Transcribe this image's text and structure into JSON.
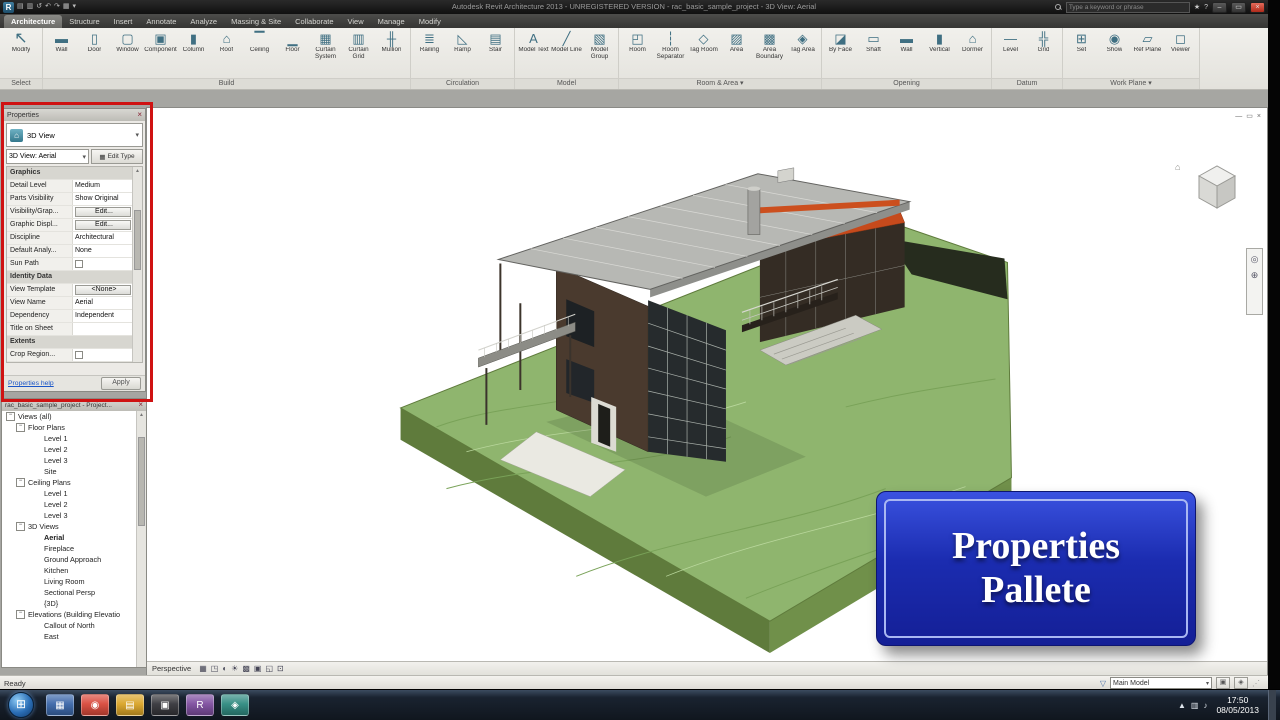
{
  "colors": {
    "highlight_red": "#cf1212",
    "callout_blue": "#1b2cb0",
    "accent_orange": "#c64a1c",
    "terrain_green": "#8fb56e",
    "roof_gray": "#b7b8b4",
    "taskbar_dark": "#10161e"
  },
  "titlebar": {
    "title": "Autodesk Revit Architecture 2013 - UNREGISTERED VERSION - rac_basic_sample_project - 3D View: Aerial",
    "logo": "R",
    "qat": [
      "▤",
      "▥",
      "↺",
      "↶",
      "↷",
      "▦",
      "▾"
    ],
    "search_placeholder": "Type a keyword or phrase",
    "star": "★",
    "help": "?",
    "window_buttons": {
      "minimize": "–",
      "maximize": "▭",
      "close": "×"
    }
  },
  "ribbon": {
    "tabs": [
      {
        "label": "Architecture",
        "active": true
      },
      {
        "label": "Structure"
      },
      {
        "label": "Insert"
      },
      {
        "label": "Annotate"
      },
      {
        "label": "Analyze"
      },
      {
        "label": "Massing & Site"
      },
      {
        "label": "Collaborate"
      },
      {
        "label": "View"
      },
      {
        "label": "Manage"
      },
      {
        "label": "Modify"
      }
    ],
    "panels": [
      {
        "label": "Select",
        "tools": [
          {
            "label": "Modify",
            "glyph": "↖"
          }
        ]
      },
      {
        "label": "Build",
        "tools": [
          {
            "label": "Wall",
            "glyph": "▬"
          },
          {
            "label": "Door",
            "glyph": "▯"
          },
          {
            "label": "Window",
            "glyph": "▢"
          },
          {
            "label": "Component",
            "glyph": "▣"
          },
          {
            "label": "Column",
            "glyph": "▮"
          },
          {
            "label": "Roof",
            "glyph": "⌂"
          },
          {
            "label": "Ceiling",
            "glyph": "▔"
          },
          {
            "label": "Floor",
            "glyph": "▁"
          },
          {
            "label": "Curtain System",
            "glyph": "▦"
          },
          {
            "label": "Curtain Grid",
            "glyph": "▥"
          },
          {
            "label": "Mullion",
            "glyph": "╫"
          }
        ]
      },
      {
        "label": "Circulation",
        "tools": [
          {
            "label": "Railing",
            "glyph": "≣"
          },
          {
            "label": "Ramp",
            "glyph": "◺"
          },
          {
            "label": "Stair",
            "glyph": "▤"
          }
        ]
      },
      {
        "label": "Model",
        "tools": [
          {
            "label": "Model Text",
            "glyph": "A"
          },
          {
            "label": "Model Line",
            "glyph": "╱"
          },
          {
            "label": "Model Group",
            "glyph": "▧"
          }
        ]
      },
      {
        "label": "Room & Area ▾",
        "tools": [
          {
            "label": "Room",
            "glyph": "◰"
          },
          {
            "label": "Room Separator",
            "glyph": "┆"
          },
          {
            "label": "Tag Room",
            "glyph": "◇"
          },
          {
            "label": "Area",
            "glyph": "▨"
          },
          {
            "label": "Area Boundary",
            "glyph": "▩"
          },
          {
            "label": "Tag Area",
            "glyph": "◈"
          }
        ]
      },
      {
        "label": "Opening",
        "tools": [
          {
            "label": "By Face",
            "glyph": "◪"
          },
          {
            "label": "Shaft",
            "glyph": "▭"
          },
          {
            "label": "Wall",
            "glyph": "▬"
          },
          {
            "label": "Vertical",
            "glyph": "▮"
          },
          {
            "label": "Dormer",
            "glyph": "⌂"
          }
        ]
      },
      {
        "label": "Datum",
        "tools": [
          {
            "label": "Level",
            "glyph": "—"
          },
          {
            "label": "Grid",
            "glyph": "╬"
          }
        ]
      },
      {
        "label": "Work Plane ▾",
        "tools": [
          {
            "label": "Set",
            "glyph": "⊞"
          },
          {
            "label": "Show",
            "glyph": "◉"
          },
          {
            "label": "Ref Plane",
            "glyph": "▱"
          },
          {
            "label": "Viewer",
            "glyph": "◻"
          }
        ]
      }
    ]
  },
  "properties": {
    "header": "Properties",
    "close": "×",
    "type_glyph": "⌂",
    "type_label": "3D View",
    "dropdown": "▾",
    "instance": "3D View: Aerial",
    "edit_type_glyph": "▦",
    "edit_type": "Edit Type",
    "rows": [
      {
        "label": "Graphics",
        "section": true
      },
      {
        "label": "Detail Level",
        "value": "Medium"
      },
      {
        "label": "Parts Visibility",
        "value": "Show Original"
      },
      {
        "label": "Visibility/Grap...",
        "value": "Edit...",
        "button": true
      },
      {
        "label": "Graphic Displ...",
        "value": "Edit...",
        "button": true
      },
      {
        "label": "Discipline",
        "value": "Architectural"
      },
      {
        "label": "Default Analy...",
        "value": "None"
      },
      {
        "label": "Sun Path",
        "checkbox": true
      },
      {
        "label": "Identity Data",
        "section": true
      },
      {
        "label": "View Template",
        "value": "<None>",
        "button": true
      },
      {
        "label": "View Name",
        "value": "Aerial"
      },
      {
        "label": "Dependency",
        "value": "Independent"
      },
      {
        "label": "Title on Sheet",
        "value": ""
      },
      {
        "label": "Extents",
        "section": true
      },
      {
        "label": "Crop Region...",
        "checkbox": true
      }
    ],
    "help": "Properties help",
    "apply": "Apply"
  },
  "project_browser": {
    "header": "rac_basic_sample_project - Project...",
    "close": "×",
    "items": [
      {
        "label": "Views (all)",
        "exp": "−",
        "pad": "4px"
      },
      {
        "label": "Floor Plans",
        "exp": "−",
        "pad": "14px"
      },
      {
        "label": "Level 1",
        "exp": "",
        "pad": "30px"
      },
      {
        "label": "Level 2",
        "exp": "",
        "pad": "30px"
      },
      {
        "label": "Level 3",
        "exp": "",
        "pad": "30px"
      },
      {
        "label": "Site",
        "exp": "",
        "pad": "30px"
      },
      {
        "label": "Ceiling Plans",
        "exp": "−",
        "pad": "14px"
      },
      {
        "label": "Level 1",
        "exp": "",
        "pad": "30px"
      },
      {
        "label": "Level 2",
        "exp": "",
        "pad": "30px"
      },
      {
        "label": "Level 3",
        "exp": "",
        "pad": "30px"
      },
      {
        "label": "3D Views",
        "exp": "−",
        "pad": "14px"
      },
      {
        "label": "Aerial",
        "exp": "",
        "pad": "30px",
        "bold": true
      },
      {
        "label": "Fireplace",
        "exp": "",
        "pad": "30px"
      },
      {
        "label": "Ground Approach",
        "exp": "",
        "pad": "30px"
      },
      {
        "label": "Kitchen",
        "exp": "",
        "pad": "30px"
      },
      {
        "label": "Living Room",
        "exp": "",
        "pad": "30px"
      },
      {
        "label": "Sectional Persp",
        "exp": "",
        "pad": "30px"
      },
      {
        "label": "{3D}",
        "exp": "",
        "pad": "30px"
      },
      {
        "label": "Elevations (Building Elevatio",
        "exp": "−",
        "pad": "14px"
      },
      {
        "label": "Callout of North",
        "exp": "",
        "pad": "30px"
      },
      {
        "label": "East",
        "exp": "",
        "pad": "30px"
      }
    ]
  },
  "canvas": {
    "viewbar": {
      "label": "Perspective",
      "icons": [
        "▦",
        "◳",
        "◐",
        "☀",
        "▩",
        "▣",
        "◱",
        "⊡"
      ]
    },
    "view_window_buttons": {
      "minimize": "—",
      "restore": "▭",
      "close": "×"
    },
    "viewcube_home": "⌂",
    "navbar": {
      "wheel": "◎",
      "zoom": "⊕"
    },
    "callout": {
      "line1": "Properties",
      "line2": "Pallete"
    }
  },
  "statusbar": {
    "ready": "Ready",
    "filter_glyph": "▽",
    "design_option": "Main Model",
    "toggle1": "▣",
    "toggle2": "◈",
    "grip": "⋰"
  },
  "taskbar": {
    "start_glyph": "⊞",
    "apps": [
      {
        "name": "taskbar-app-blue",
        "color": "#3a66a8",
        "glyph": "▦"
      },
      {
        "name": "taskbar-chrome",
        "color": "#d8483a",
        "glyph": "◉"
      },
      {
        "name": "taskbar-folder",
        "color": "#d9a326",
        "glyph": "▤"
      },
      {
        "name": "taskbar-app-dark",
        "color": "#35353a",
        "glyph": "▣"
      },
      {
        "name": "taskbar-revit",
        "color": "#7d4d9e",
        "glyph": "R"
      },
      {
        "name": "taskbar-app-teal",
        "color": "#2e8a80",
        "glyph": "◈"
      }
    ],
    "tray": {
      "expand": "▲",
      "network": "▥",
      "volume": "♪",
      "time": "17:50",
      "date": "08/05/2013"
    }
  }
}
